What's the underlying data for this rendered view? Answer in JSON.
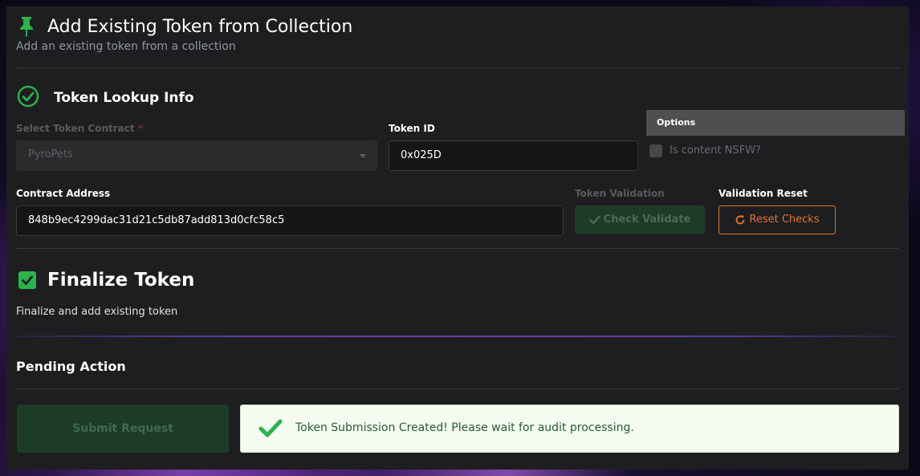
{
  "header": {
    "title": "Add Existing Token from Collection",
    "subtitle": "Add an existing token from a collection"
  },
  "lookup": {
    "section_title": "Token Lookup Info",
    "contract_select": {
      "label": "Select Token Contract",
      "required_mark": "*",
      "value": "PyroPets"
    },
    "token_id": {
      "label": "Token ID",
      "value": "0x025D"
    },
    "options": {
      "title": "Options",
      "nsfw_label": "Is content NSFW?",
      "nsfw_checked": false
    },
    "contract_address": {
      "label": "Contract Address",
      "value": "848b9ec4299dac31d21c5db87add813d0cfc58c5"
    },
    "validation": {
      "label": "Token Validation",
      "button": "Check Validate"
    },
    "reset": {
      "label": "Validation Reset",
      "button": "Reset Checks"
    }
  },
  "finalize": {
    "section_title": "Finalize Token",
    "description": "Finalize and add existing token"
  },
  "pending": {
    "section_title": "Pending Action",
    "submit_button": "Submit Request",
    "alert_message": "Token Submission Created! Please wait for audit processing."
  },
  "colors": {
    "accent_green": "#2bb24c",
    "accent_orange": "#e4742c",
    "panel_bg": "#1e1e20"
  }
}
